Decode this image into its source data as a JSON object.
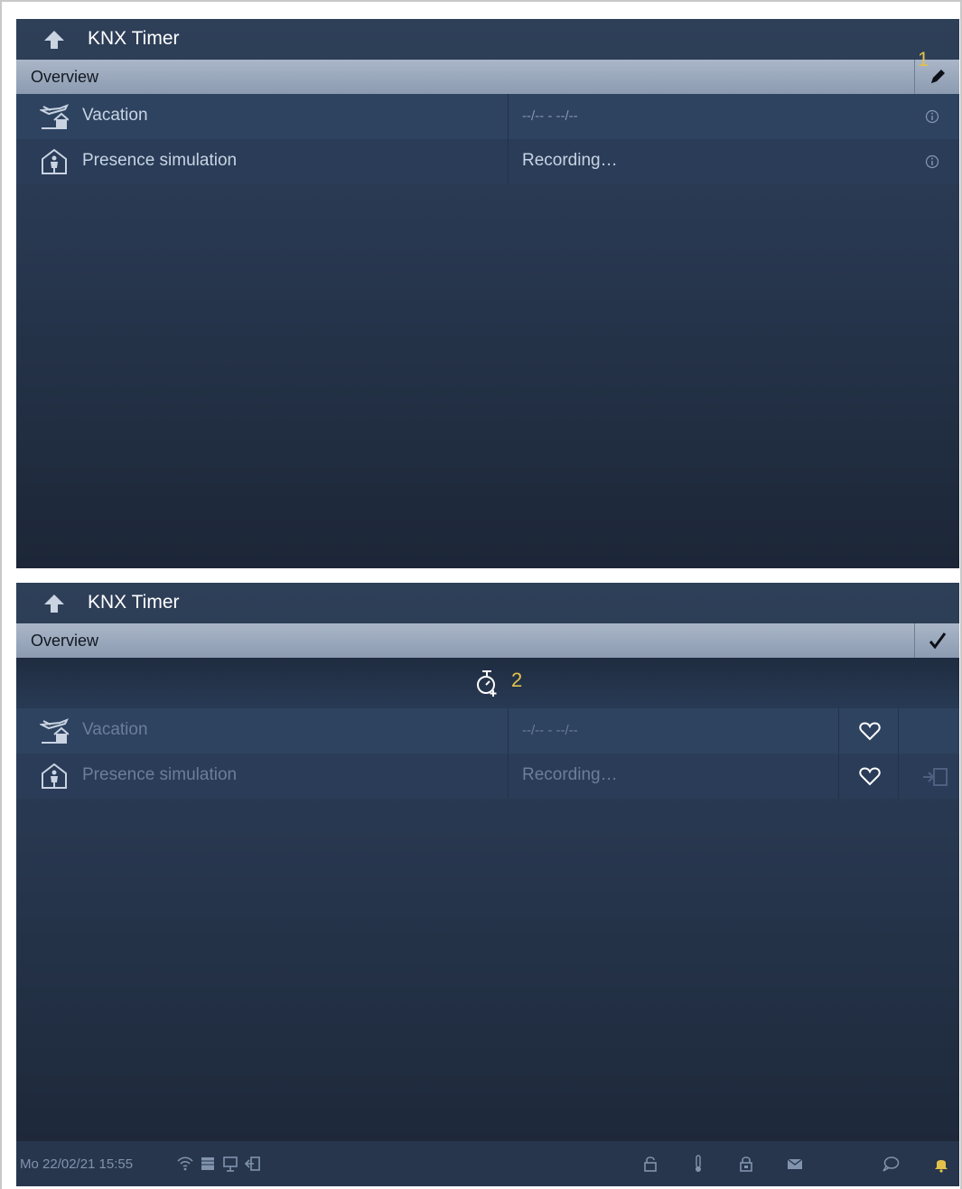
{
  "screen1": {
    "title": "KNX Timer",
    "overview_label": "Overview",
    "edit_marker": "1",
    "rows": [
      {
        "label": "Vacation",
        "value": "--/-- - --/--",
        "icon": "vacation-plane-icon"
      },
      {
        "label": "Presence simulation",
        "value": "Recording…",
        "icon": "presence-house-icon"
      }
    ]
  },
  "screen2": {
    "title": "KNX Timer",
    "overview_label": "Overview",
    "add_marker": "2",
    "rows": [
      {
        "label": "Vacation",
        "value": "--/-- - --/--",
        "icon": "vacation-plane-icon"
      },
      {
        "label": "Presence simulation",
        "value": "Recording…",
        "icon": "presence-house-icon"
      }
    ]
  },
  "statusbar": {
    "datetime": "Mo 22/02/21  15:55",
    "icons": [
      "wifi-icon",
      "shutter-icon",
      "display-icon",
      "logout-icon",
      "lock-icon",
      "thermometer-icon",
      "alarm-lock-icon",
      "mail-icon",
      "chat-icon",
      "bell-icon"
    ]
  },
  "colors": {
    "panel_top": "#2e3f58",
    "panel_bottom": "#1c2637",
    "overview_bar": "#aab6c8",
    "marker": "#e3c24a"
  }
}
